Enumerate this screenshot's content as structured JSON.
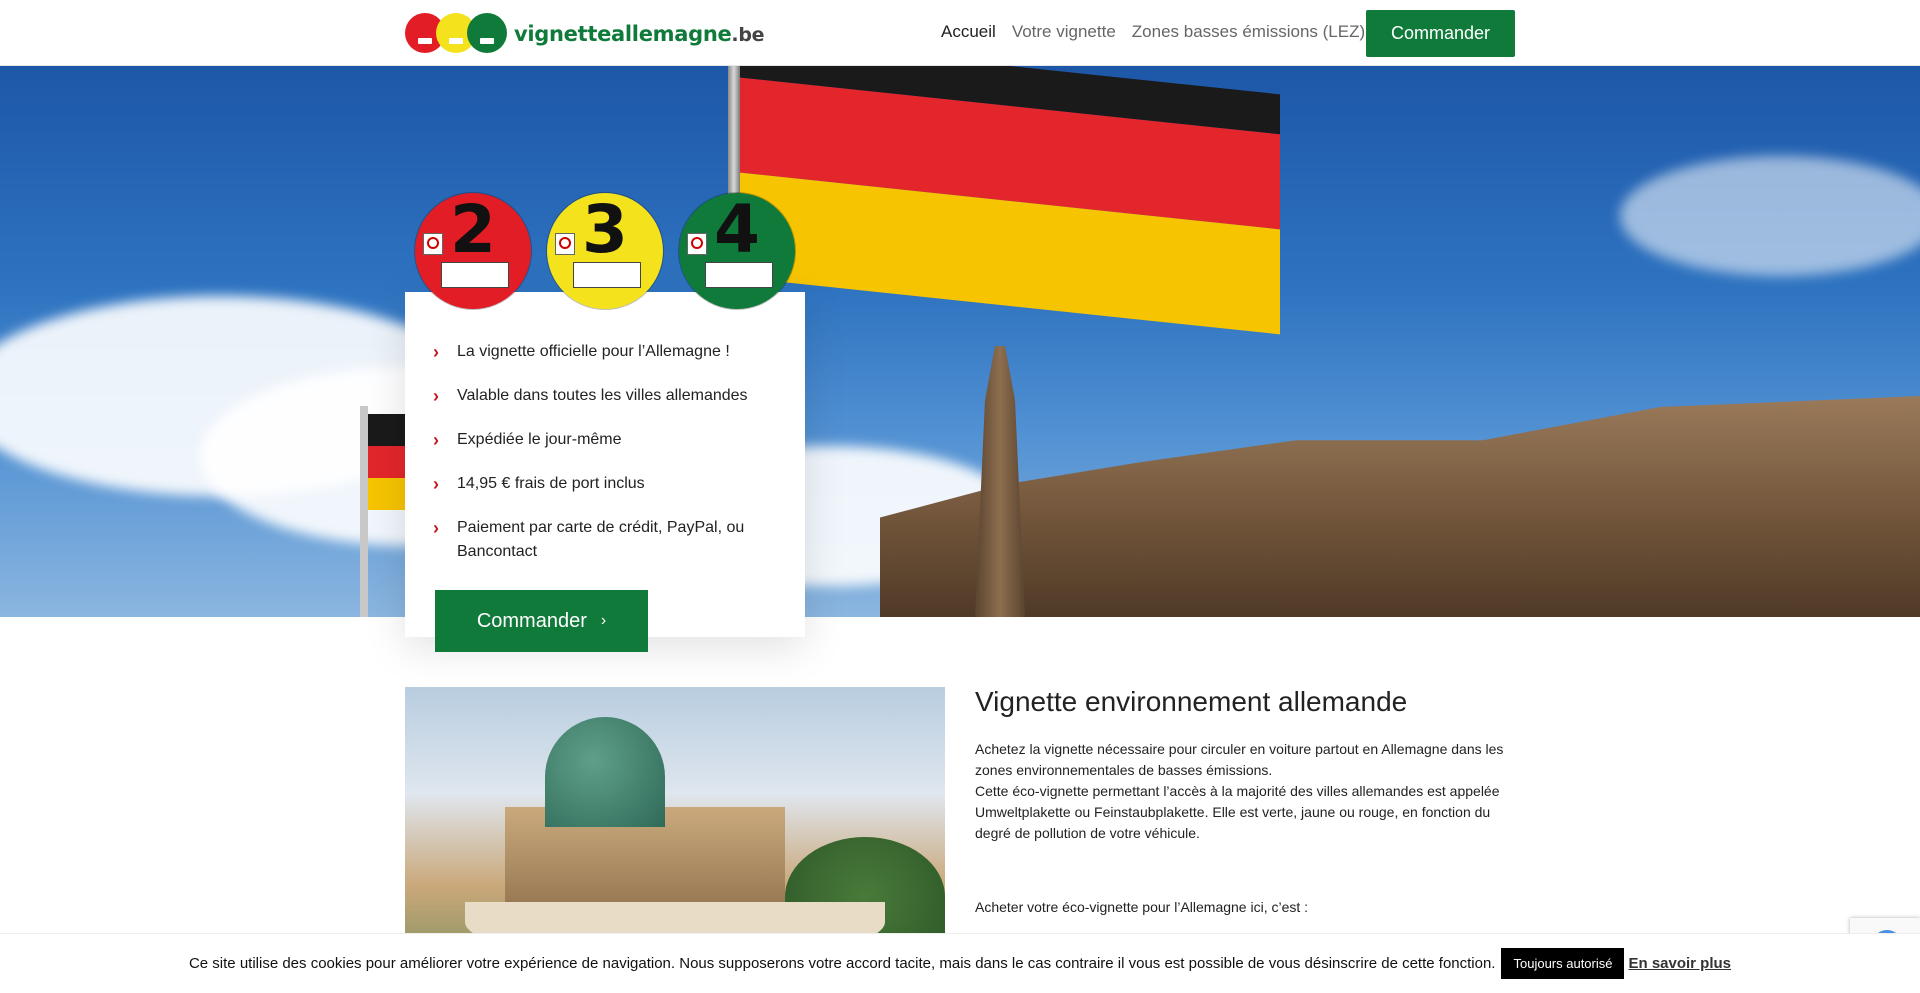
{
  "header": {
    "logo_main": "vignetteallemagne",
    "logo_tld": ".be",
    "nav": [
      {
        "label": "Accueil"
      },
      {
        "label": "Votre vignette"
      },
      {
        "label": "Zones basses émissions (LEZ)"
      }
    ],
    "order_label": "Commander"
  },
  "hero": {
    "badges": [
      {
        "number": "2",
        "color": "#e21d25"
      },
      {
        "number": "3",
        "color": "#f3e21c"
      },
      {
        "number": "4",
        "color": "#0f7a3a"
      }
    ],
    "features": [
      "La vignette officielle pour l’Allemagne !",
      "Valable dans toutes les villes allemandes",
      "Expédiée le jour-même",
      "14,95 € frais de port inclus",
      "Paiement par carte de crédit, PayPal, ou Bancontact"
    ],
    "order_label": "Commander"
  },
  "content": {
    "title": "Vignette environnement allemande",
    "p1": "Achetez la vignette nécessaire pour circuler en voiture partout en Allemagne dans les zones environnementales de basses émissions.",
    "p2": "Cette éco-vignette permettant l’accès à la majorité des villes allemandes est appelée Umweltplakette ou Feinstaubplakette. Elle est verte, jaune ou rouge, en fonction du degré de pollution de votre véhicule.",
    "p3": "Acheter votre éco-vignette pour l’Allemagne ici, c’est :"
  },
  "cookie": {
    "text": "Ce site utilise des cookies pour améliorer votre expérience de navigation. Nous supposerons votre accord tacite, mais dans le cas contraire il vous est possible de vous désinscrire de cette fonction.",
    "accept_label": "Toujours autorisé",
    "more_label": "En savoir plus"
  },
  "colors": {
    "brand_green": "#0f7a3a",
    "chevron_red": "#c01b22"
  }
}
